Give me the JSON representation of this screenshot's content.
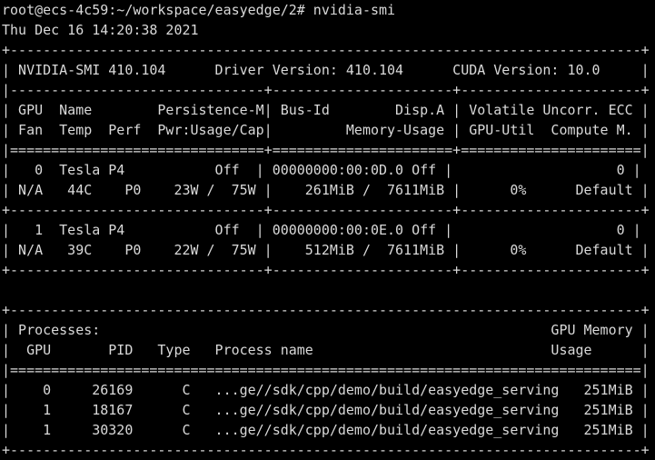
{
  "terminal": {
    "colors": {
      "background": "#000000",
      "foreground": "#d9d9d9"
    },
    "prompt": {
      "user_host_path": "root@ecs-4c59:~/workspace/easyedge/2#",
      "command": "nvidia-smi",
      "full_line": "root@ecs-4c59:~/workspace/easyedge/2# nvidia-smi"
    },
    "timestamp": "Thu Dec 16 14:20:38 2021",
    "smi_header": {
      "tool_version_label": "NVIDIA-SMI 410.104",
      "driver_version_label": "Driver Version: 410.104",
      "cuda_version_label": "CUDA Version: 10.0",
      "tool_version": "410.104",
      "driver_version": "410.104",
      "cuda_version": "10.0"
    },
    "device_table": {
      "header_row_1": [
        "GPU",
        "Name",
        "Persistence-M",
        "Bus-Id",
        "Disp.A",
        "Volatile Uncorr. ECC"
      ],
      "header_row_2": [
        "Fan",
        "Temp",
        "Perf",
        "Pwr:Usage/Cap",
        "Memory-Usage",
        "GPU-Util",
        "Compute M."
      ],
      "rows": [
        {
          "gpu": "0",
          "name": "Tesla P4",
          "persistence_m": "Off",
          "bus_id": "00000000:00:0D.0",
          "disp_a": "Off",
          "ecc": "0",
          "fan": "N/A",
          "temp": "44C",
          "perf": "P0",
          "pwr_usage": "23W",
          "pwr_cap": "75W",
          "mem_used": "261MiB",
          "mem_total": "7611MiB",
          "gpu_util": "0%",
          "compute_m": "Default"
        },
        {
          "gpu": "1",
          "name": "Tesla P4",
          "persistence_m": "Off",
          "bus_id": "00000000:00:0E.0",
          "disp_a": "Off",
          "ecc": "0",
          "fan": "N/A",
          "temp": "39C",
          "perf": "P0",
          "pwr_usage": "22W",
          "pwr_cap": "75W",
          "mem_used": "512MiB",
          "mem_total": "7611MiB",
          "gpu_util": "0%",
          "compute_m": "Default"
        }
      ]
    },
    "processes_table": {
      "title": "Processes:",
      "gpu_memory_label": "GPU Memory",
      "header_row": [
        "GPU",
        "PID",
        "Type",
        "Process name"
      ],
      "usage_label": "Usage",
      "rows": [
        {
          "gpu": "0",
          "pid": "26169",
          "type": "C",
          "process_name": "...ge//sdk/cpp/demo/build/easyedge_serving",
          "usage": "251MiB"
        },
        {
          "gpu": "1",
          "pid": "18167",
          "type": "C",
          "process_name": "...ge//sdk/cpp/demo/build/easyedge_serving",
          "usage": "251MiB"
        },
        {
          "gpu": "1",
          "pid": "30320",
          "type": "C",
          "process_name": "...ge//sdk/cpp/demo/build/easyedge_serving",
          "usage": "251MiB"
        }
      ]
    },
    "rendered_lines": [
      "root@ecs-4c59:~/workspace/easyedge/2# nvidia-smi",
      "Thu Dec 16 14:20:38 2021",
      "+-----------------------------------------------------------------------------+",
      "| NVIDIA-SMI 410.104      Driver Version: 410.104      CUDA Version: 10.0     |",
      "|-------------------------------+----------------------+----------------------+",
      "| GPU  Name        Persistence-M| Bus-Id        Disp.A | Volatile Uncorr. ECC |",
      "| Fan  Temp  Perf  Pwr:Usage/Cap|         Memory-Usage | GPU-Util  Compute M. |",
      "|===============================+======================+======================|",
      "|   0  Tesla P4           Off  | 00000000:00:0D.0 Off |                    0 |",
      "| N/A   44C    P0    23W /  75W |    261MiB /  7611MiB |      0%      Default |",
      "+-------------------------------+----------------------+----------------------+",
      "|   1  Tesla P4           Off  | 00000000:00:0E.0 Off |                    0 |",
      "| N/A   39C    P0    22W /  75W |    512MiB /  7611MiB |      0%      Default |",
      "+-------------------------------+----------------------+----------------------+",
      "",
      "+-----------------------------------------------------------------------------+",
      "| Processes:                                                       GPU Memory |",
      "|  GPU       PID   Type   Process name                             Usage      |",
      "|=============================================================================|",
      "|    0     26169      C   ...ge//sdk/cpp/demo/build/easyedge_serving   251MiB |",
      "|    1     18167      C   ...ge//sdk/cpp/demo/build/easyedge_serving   251MiB |",
      "|    1     30320      C   ...ge//sdk/cpp/demo/build/easyedge_serving   251MiB |",
      "+-----------------------------------------------------------------------------+"
    ]
  }
}
